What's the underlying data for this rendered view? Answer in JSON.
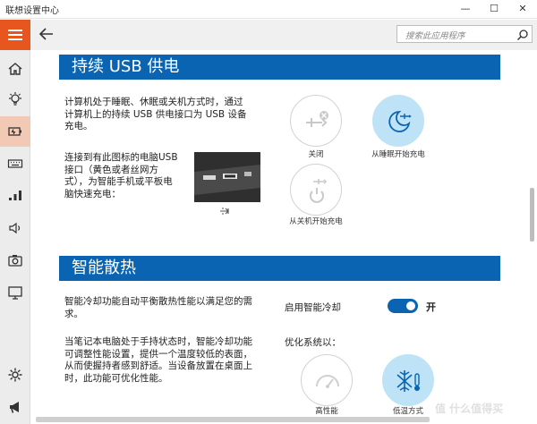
{
  "window": {
    "title": "联想设置中心",
    "minimize": "—",
    "maximize": "☐",
    "close": "✕"
  },
  "search": {
    "placeholder": "搜索此应用程序"
  },
  "sidebar": {
    "items": [
      {
        "icon": "home-icon"
      },
      {
        "icon": "lightbulb-icon"
      },
      {
        "icon": "battery-icon",
        "active": true
      },
      {
        "icon": "keyboard-icon"
      },
      {
        "icon": "network-icon"
      },
      {
        "icon": "audio-icon"
      },
      {
        "icon": "camera-icon"
      },
      {
        "icon": "display-icon"
      },
      {
        "icon": "gear-icon"
      },
      {
        "icon": "megaphone-icon"
      }
    ]
  },
  "usb_section": {
    "title": "持续 USB 供电",
    "description": "计算机处于睡眠、休眠或关机方式时，通过计算机上的持续 USB 供电接口为 USB 设备充电。",
    "desc_lines": [
      "计算机处于睡眠、休眠或关机方式时，通过",
      "计算机上的持续 USB 供电接口为 USB 设备",
      "充电。"
    ],
    "port_note_lines": [
      "连接到有此图标的电脑USB",
      "接口（黄色或者丝网方",
      "式），为智能手机或平板电",
      "脑快速充电："
    ],
    "options": [
      {
        "label": "关闭",
        "selected": false
      },
      {
        "label": "从睡眠开始充电",
        "selected": true
      },
      {
        "label": "从关机开始充电",
        "selected": false
      }
    ]
  },
  "cooling_section": {
    "title": "智能散热",
    "desc1_lines": [
      "智能冷却功能自动平衡散热性能以满足您的需",
      "求。"
    ],
    "desc2_lines": [
      "当笔记本电脑处于手持状态时，智能冷却功能",
      "可调整性能设置，提供一个温度较低的表面，",
      "从而使握持者感到舒适。当设备放置在桌面上",
      "时，此功能可优化性能。"
    ],
    "toggle_label": "启用智能冷却",
    "toggle_state": "开",
    "toggle_on": true,
    "optimize_label": "优化系统以：",
    "modes": [
      {
        "label": "高性能",
        "selected": false
      },
      {
        "label": "低温方式",
        "selected": true
      }
    ]
  },
  "watermark": "值 什么值得买",
  "colors": {
    "accent": "#e8561f",
    "banner": "#0a64b1",
    "selected": "#bfe3f6"
  }
}
